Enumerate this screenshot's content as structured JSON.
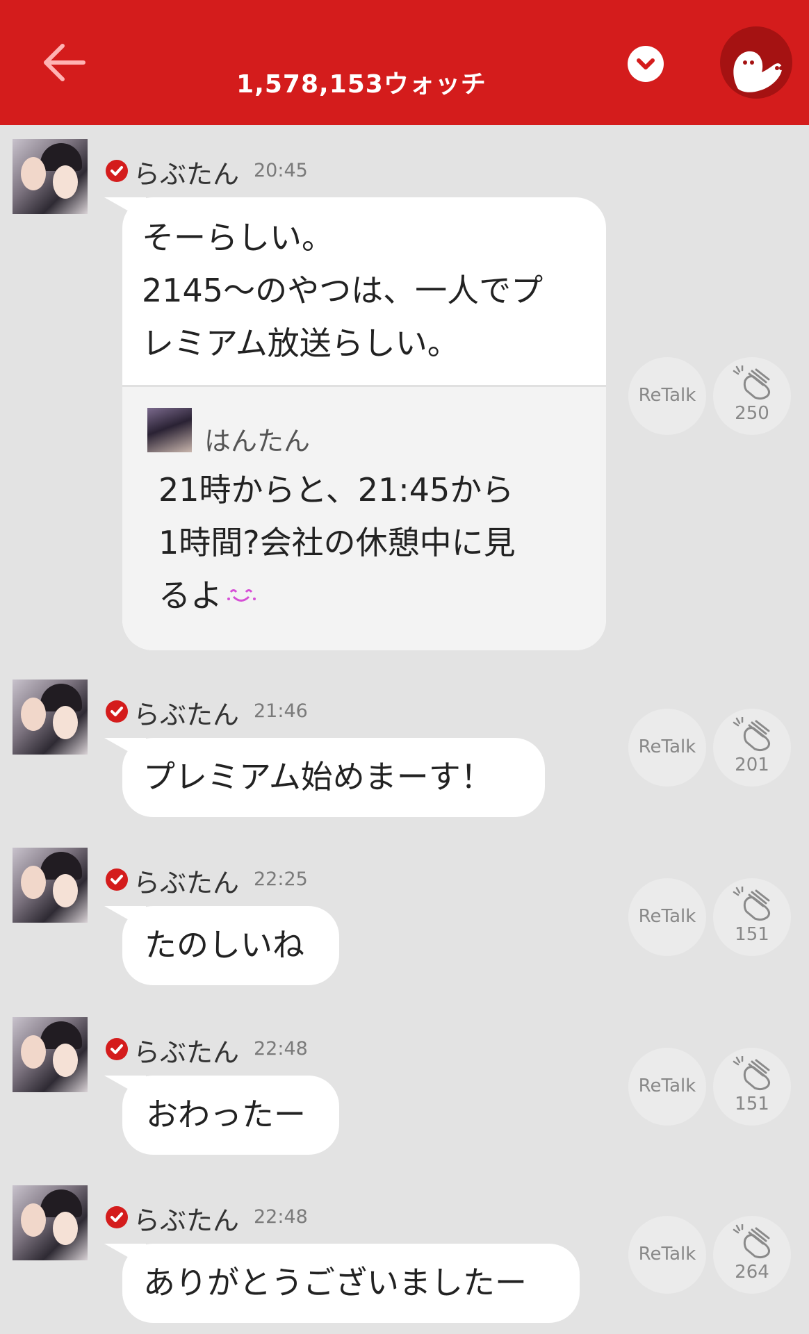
{
  "header": {
    "watch_count": "1,578,153ウォッチ",
    "back_icon": "arrow-left-icon",
    "dropdown_icon": "chevron-down-icon",
    "brand_color": "#d41c1c"
  },
  "messages": [
    {
      "username": "らぶたん",
      "time": "20:45",
      "lines": [
        "そーらしい。",
        "2145〜のやつは、一人でプ",
        "レミアム放送らしい。"
      ],
      "quote": {
        "username": "はんたん",
        "lines": [
          "21時からと、21:45から",
          "1時間?会社の休憩中に見",
          "るよ"
        ],
        "emoji": "smiling-face-icon"
      },
      "retalk_label": "ReTalk",
      "clap_count": "250"
    },
    {
      "username": "らぶたん",
      "time": "21:46",
      "lines": [
        "プレミアム始めまーす！"
      ],
      "retalk_label": "ReTalk",
      "clap_count": "201"
    },
    {
      "username": "らぶたん",
      "time": "22:25",
      "lines": [
        "たのしいね"
      ],
      "retalk_label": "ReTalk",
      "clap_count": "151"
    },
    {
      "username": "らぶたん",
      "time": "22:48",
      "lines": [
        "おわったー"
      ],
      "retalk_label": "ReTalk",
      "clap_count": "151"
    },
    {
      "username": "らぶたん",
      "time": "22:48",
      "lines": [
        "ありがとうございましたー"
      ],
      "retalk_label": "ReTalk",
      "clap_count": "264"
    }
  ]
}
